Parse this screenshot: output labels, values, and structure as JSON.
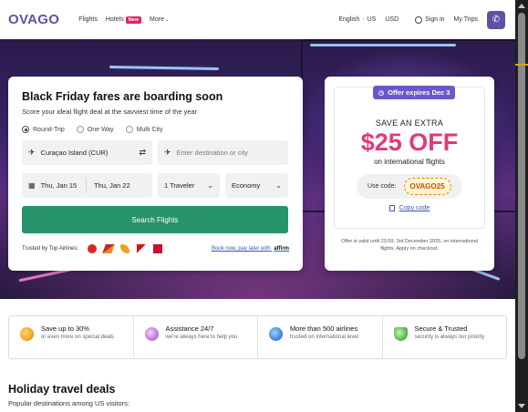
{
  "header": {
    "logo": "OVAGO",
    "nav": {
      "flights": "Flights",
      "hotels": "Hotels",
      "hotels_badge": "New",
      "more": "More"
    },
    "language": "English",
    "region": "US",
    "currency": "USD",
    "sign_in": "Sign in",
    "my_trips": "My Trips",
    "phone_icon": "phone-icon"
  },
  "search": {
    "title": "Black Friday fares are boarding soon",
    "subtitle": "Score your ideal flight deal at the savviest time of the year",
    "trip_types": [
      "Round-Trip",
      "One Way",
      "Multi City"
    ],
    "selected_trip_type": "Round-Trip",
    "origin": "Curaçao Island (CUR)",
    "destination_placeholder": "Enter destination or city",
    "depart_date": "Thu, Jan 15",
    "return_date": "Thu, Jan 22",
    "travelers": "1 Traveler",
    "cabin": "Economy",
    "button": "Search Flights",
    "trusted_label": "Trusted by Top Airlines:",
    "bnpl": "Book now, pay later with",
    "bnpl_brand": "affirm"
  },
  "promo": {
    "badge": "Offer expires Dec 3",
    "save_extra": "SAVE AN EXTRA",
    "amount": "$25 OFF",
    "on_flights": "on international flights",
    "use_code_label": "Use code:",
    "code": "OVAGO25",
    "copy_code": "Copy code",
    "validity": "Offer is valid until 23:59, 3rd December 2025, on international flights. Apply on checkout."
  },
  "features": [
    {
      "title": "Save up to 30%",
      "desc": "or even more on special deals",
      "icon": "savings-icon",
      "color": "#f5a623"
    },
    {
      "title": "Assistance 24/7",
      "desc": "we're always here to help you",
      "icon": "support-icon",
      "color": "#b86ad6"
    },
    {
      "title": "More than 500 airlines",
      "desc": "trusted on international level",
      "icon": "globe-icon",
      "color": "#3a7bd5"
    },
    {
      "title": "Secure & Trusted",
      "desc": "security is always our priority",
      "icon": "shield-icon",
      "color": "#4caf50"
    }
  ],
  "holiday": {
    "title": "Holiday travel deals",
    "subtitle": "Popular destinations among US visitors:"
  },
  "colors": {
    "brand": "#5c53a5",
    "search_button": "#27936a",
    "promo_pink": "#e2397b",
    "badge_purple": "#6b59c9"
  }
}
